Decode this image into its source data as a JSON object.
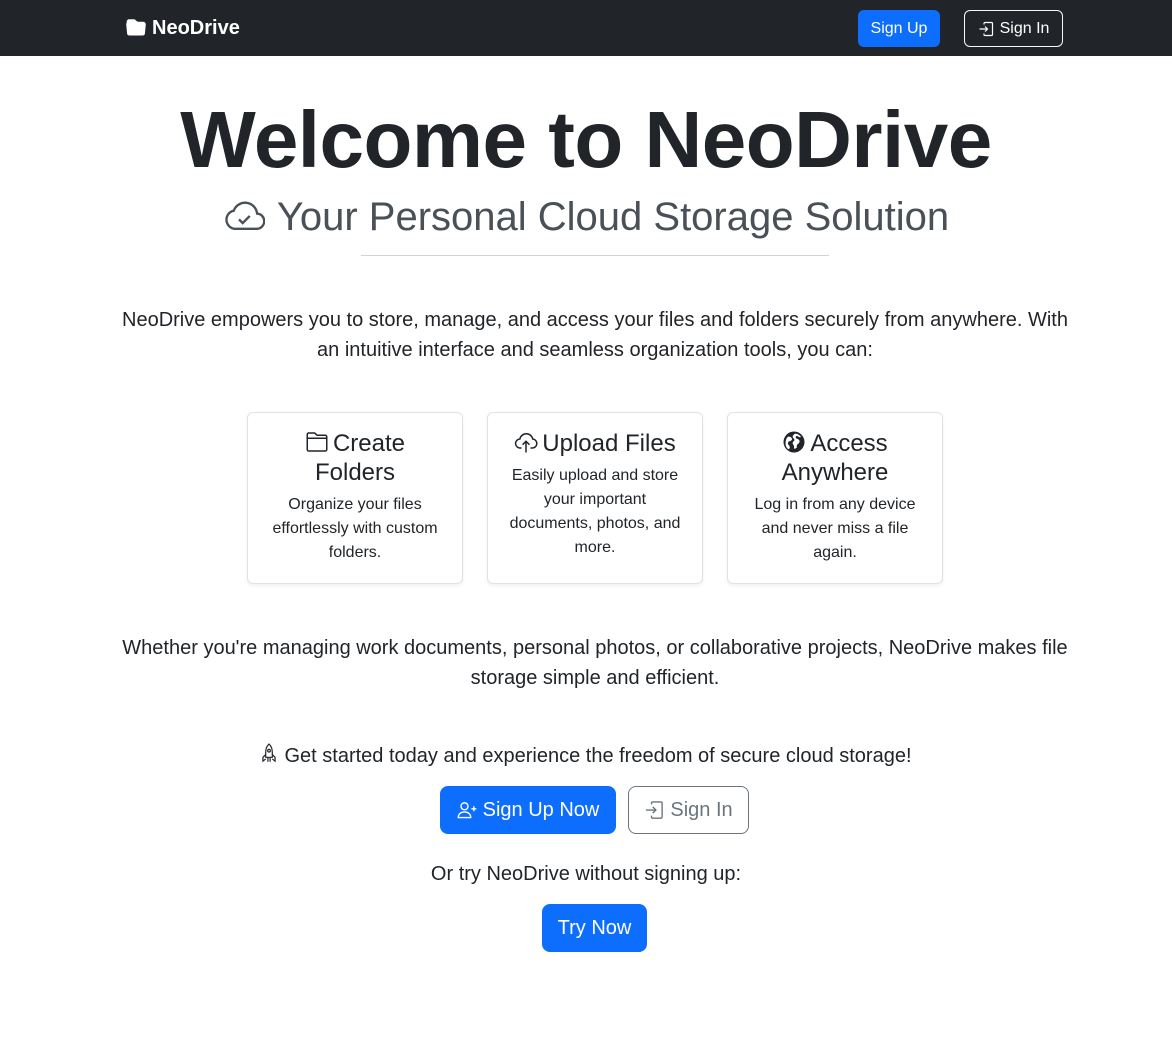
{
  "navbar": {
    "brand": "NeoDrive",
    "brand_icon": "folder-icon",
    "signup_label": "Sign Up",
    "signin_label": "Sign In",
    "signin_icon": "box-arrow-in-right-icon"
  },
  "hero": {
    "title": "Welcome to NeoDrive",
    "subtitle": "Your Personal Cloud Storage Solution",
    "subtitle_icon": "cloud-check-icon"
  },
  "intro": "NeoDrive empowers you to store, manage, and access your files and folders securely from anywhere. With an intuitive interface and seamless organization tools, you can:",
  "features": [
    {
      "icon": "folder-icon",
      "title": "Create Folders",
      "text": "Organize your files effortlessly with custom folders."
    },
    {
      "icon": "cloud-upload-icon",
      "title": "Upload Files",
      "text": "Easily upload and store your important documents, photos, and more."
    },
    {
      "icon": "globe-icon",
      "title": "Access Anywhere",
      "text": "Log in from any device and never miss a file again."
    }
  ],
  "closing": "Whether you're managing work documents, personal photos, or collaborative projects, NeoDrive makes file storage simple and efficient.",
  "cta": {
    "text": "Get started today and experience the freedom of secure cloud storage!",
    "icon": "rocket-icon",
    "signup_now_label": "Sign Up Now",
    "signup_now_icon": "person-plus-icon",
    "signin_label": "Sign In",
    "signin_icon": "box-arrow-in-right-icon"
  },
  "try": {
    "text": "Or try NeoDrive without signing up:",
    "button_label": "Try Now"
  },
  "colors": {
    "navbar_bg": "#212529",
    "primary": "#0d6efd",
    "secondary": "#6c757d"
  }
}
